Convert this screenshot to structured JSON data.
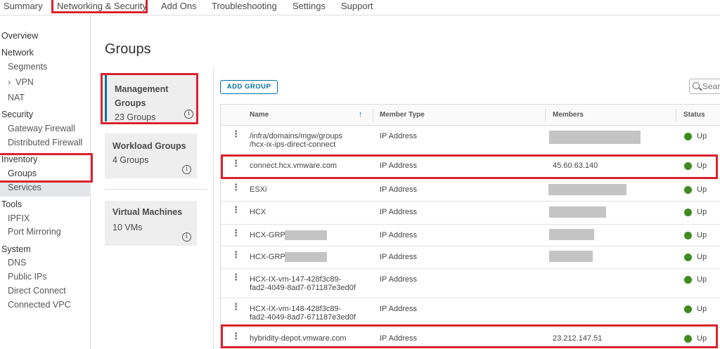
{
  "topnav": {
    "tabs": [
      "Summary",
      "Networking & Security",
      "Add Ons",
      "Troubleshooting",
      "Settings",
      "Support"
    ]
  },
  "sidebar": {
    "overview": "Overview",
    "network": {
      "label": "Network",
      "items": [
        "Segments",
        "VPN",
        "NAT"
      ]
    },
    "security": {
      "label": "Security",
      "items": [
        "Gateway Firewall",
        "Distributed Firewall"
      ]
    },
    "inventory": {
      "label": "Inventory",
      "items": [
        "Groups",
        "Services"
      ]
    },
    "tools": {
      "label": "Tools",
      "items": [
        "IPFIX",
        "Port Mirroring"
      ]
    },
    "system": {
      "label": "System",
      "items": [
        "DNS",
        "Public IPs",
        "Direct Connect",
        "Connected VPC"
      ]
    }
  },
  "main": {
    "title": "Groups",
    "cards": [
      {
        "title_line1": "Management",
        "title_line2": "Groups",
        "subtitle": "23 Groups"
      },
      {
        "title": "Workload Groups",
        "subtitle": "4 Groups"
      },
      {
        "title": "Virtual Machines",
        "subtitle": "10 VMs"
      }
    ],
    "add_group_label": "ADD GROUP",
    "search_placeholder": "Sear",
    "table": {
      "columns": [
        "Name",
        "Member Type",
        "Members",
        "Status"
      ],
      "rows": [
        {
          "name1": "/infra/domains/mgw/groups",
          "name2": "/hcx-ix-ips-direct-connect",
          "type": "IP Address",
          "members": "",
          "status": "Up"
        },
        {
          "name1": "connect.hcx.vmware.com",
          "name2": "",
          "type": "IP Address",
          "members": "45.60.63.140",
          "status": "Up"
        },
        {
          "name1": "ESXi",
          "name2": "",
          "type": "IP Address",
          "members": "",
          "status": "Up"
        },
        {
          "name1": "HCX",
          "name2": "",
          "type": "IP Address",
          "members": "",
          "status": "Up"
        },
        {
          "name1": "HCX-GRP-",
          "name2": "",
          "type": "IP Address",
          "members": "",
          "status": "Up"
        },
        {
          "name1": "HCX-GRP-",
          "name2": "",
          "type": "IP Address",
          "members": "",
          "status": "Up"
        },
        {
          "name1": "HCX-IX-vm-147-428f3c89-",
          "name2": "fad2-4049-8ad7-671187e3ed0f",
          "type": "IP Address",
          "members": "",
          "status": "Up"
        },
        {
          "name1": "HCX-IX-vm-148-428f3c89-",
          "name2": "fad2-4049-8ad7-671187e3ed0f",
          "type": "IP Address",
          "members": "",
          "status": "Up"
        },
        {
          "name1": "hybridity-depot.vmware.com",
          "name2": "",
          "type": "IP Address",
          "members": "23.212.147.51",
          "status": "Up"
        }
      ]
    }
  },
  "colors": {
    "accent": "#0072a3",
    "status_up": "#3c8c1e",
    "highlight": "#d9232e"
  }
}
